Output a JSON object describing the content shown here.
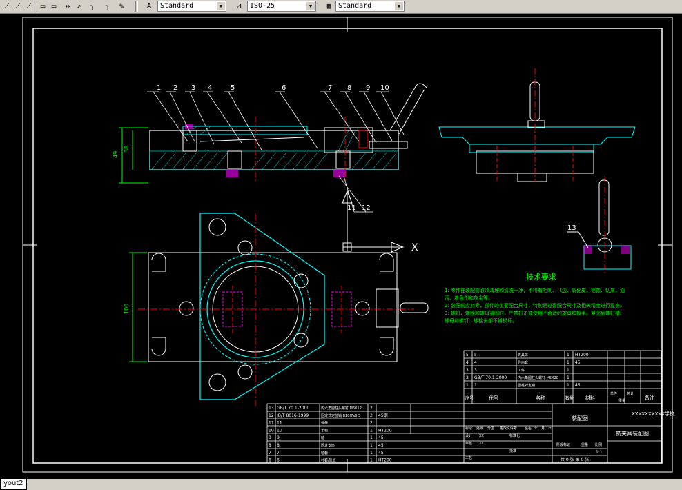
{
  "toolbar": {
    "combo1": "Standard",
    "combo2": "ISO-25",
    "combo3": "Standard"
  },
  "statusbar": {
    "layout_tab": "yout2"
  },
  "drawing": {
    "part_numbers": [
      "1",
      "2",
      "3",
      "4",
      "5",
      "6",
      "7",
      "8",
      "9",
      "10",
      "11",
      "12",
      "13"
    ],
    "dim_49": "49",
    "dim_38": "38",
    "dim_100": "100",
    "axis_x": "X",
    "tech_title": "技术要求",
    "tech_lines": [
      "1: 零件在装配前必须清理和清洗干净，不得有毛刺、飞边、氧化皮、锈蚀、切屑、油",
      "污、着色剂和灰尘等。",
      "2: 装配前应对零、部件的主要配合尺寸，特别是过盈配合尺寸及相关精度进行复查。",
      "3: 螺钉、螺栓和螺母紧固时，严禁打击或使用不合适的旋具和扳手。紧固后螺钉槽、",
      "螺母和螺钉、螺栓头部不得损坏。"
    ],
    "upper_table_rows": [
      {
        "no": "5",
        "code": "5",
        "name": "夹具体",
        "qty": "1",
        "mat": "HT200"
      },
      {
        "no": "4",
        "code": "4",
        "name": "导向套",
        "qty": "1",
        "mat": "45"
      },
      {
        "no": "3",
        "code": "3",
        "name": "工件",
        "qty": "1",
        "mat": ""
      },
      {
        "no": "2",
        "code": "GB/T 70.1-2000",
        "name": "内六角圆柱头螺钉 M5X20",
        "qty": "1",
        "mat": ""
      },
      {
        "no": "1",
        "code": "1",
        "name": "圆柱对定销",
        "qty": "1",
        "mat": "45"
      }
    ],
    "upper_header": {
      "no": "序号",
      "code": "代号",
      "name": "名称",
      "qty": "数量",
      "mat": "材料",
      "w1": "单件",
      "w2": "总计",
      "weight": "重量",
      "note": "备注"
    },
    "lower_table_rows": [
      {
        "no": "13",
        "code": "GB/T 70.1-2000",
        "name": "内六角圆柱头螺钉 M6X12",
        "qty": "2",
        "mat": ""
      },
      {
        "no": "12",
        "code": "JB/T 8016-1999",
        "name": "固定式定位销 B10f7x6.5",
        "qty": "2",
        "mat": "45钢"
      },
      {
        "no": "11",
        "code": "11",
        "name": "螺母",
        "qty": "2",
        "mat": ""
      },
      {
        "no": "10",
        "code": "10",
        "name": "手柄",
        "qty": "1",
        "mat": "HT200"
      },
      {
        "no": "9",
        "code": "9",
        "name": "轴",
        "qty": "1",
        "mat": "45"
      },
      {
        "no": "8",
        "code": "8",
        "name": "固定支座",
        "qty": "1",
        "mat": "45"
      },
      {
        "no": "7",
        "code": "7",
        "name": "轴套",
        "qty": "1",
        "mat": "45"
      },
      {
        "no": "6",
        "code": "6",
        "name": "衬套/垫板",
        "qty": "1",
        "mat": "HT200"
      }
    ],
    "title_block": {
      "school": "XXXXXXXXXX学校",
      "drawing_name": "装配图",
      "product_name": "铣夹具装配图",
      "scale": "1:1",
      "sheet": "共 0 张 第 0 张",
      "designer": "设计",
      "designer_val": "XX",
      "checker": "审核",
      "checker_val": "XX",
      "process": "工艺",
      "std": "标准化",
      "approve": "批准",
      "marks": "标记",
      "count": "处数",
      "zone": "分区",
      "docno": "更改文件号",
      "sign": "签名",
      "date": "年、月、日",
      "stage": "阶段标记",
      "weight": "重量",
      "ratio": "比例"
    }
  }
}
